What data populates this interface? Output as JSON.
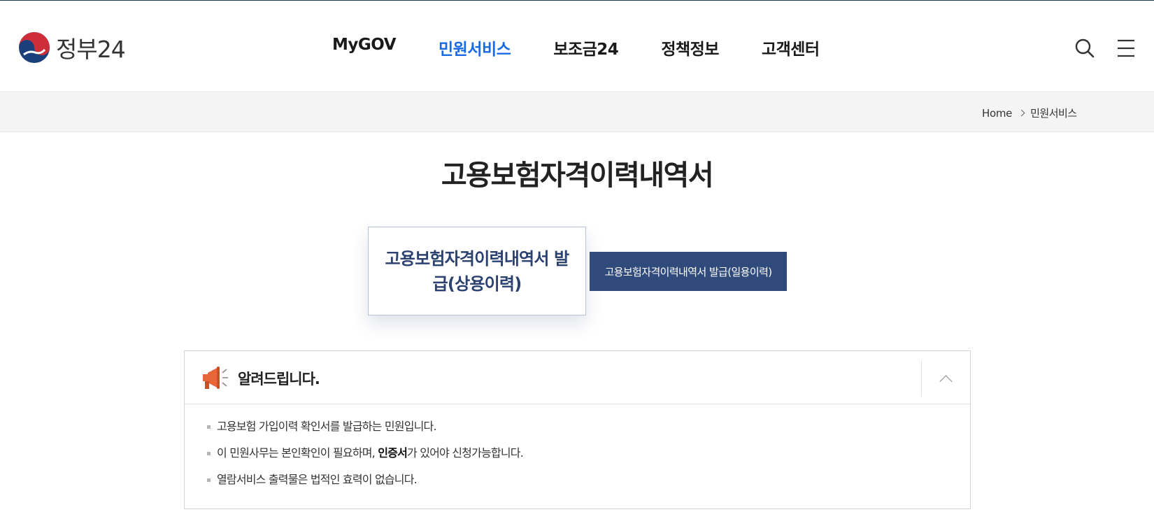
{
  "header": {
    "logo_text": "정부24",
    "nav": [
      {
        "label": "MyGOV",
        "active": false
      },
      {
        "label": "민원서비스",
        "active": true
      },
      {
        "label": "보조금24",
        "active": false
      },
      {
        "label": "정책정보",
        "active": false
      },
      {
        "label": "고객센터",
        "active": false
      }
    ],
    "search_icon": "search-icon",
    "menu_icon": "hamburger-menu-icon"
  },
  "breadcrumb": {
    "home": "Home",
    "current": "민원서비스"
  },
  "page": {
    "title": "고용보험자격이력내역서"
  },
  "tabs": {
    "main_label": "고용보험자격이력내역서 발급(상용이력)",
    "sub_label": "고용보험자격이력내역서 발급(일용이력)"
  },
  "notice": {
    "title": "알려드립니다.",
    "icon": "megaphone-icon",
    "toggle_icon": "chevron-up-icon",
    "items": [
      {
        "text": "고용보험 가입이력 확인서를 발급하는 민원입니다."
      },
      {
        "before": "이 민원사무는 본인확인이 필요하며, ",
        "strong": "인증서",
        "after": "가 있어야 신청가능합니다."
      },
      {
        "text": "열람서비스 출력물은 법적인 효력이 없습니다."
      }
    ]
  },
  "colors": {
    "accent_blue": "#1a6ae6",
    "navy_button": "#304b7b",
    "tab_text": "#2b4170",
    "megaphone_orange": "#e8653a"
  }
}
